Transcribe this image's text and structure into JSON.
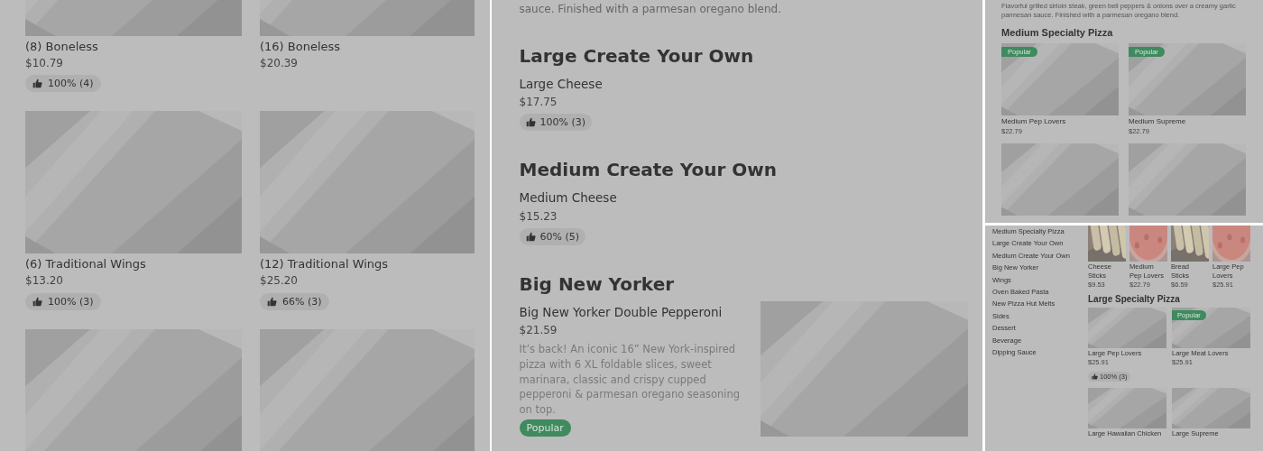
{
  "wings_panel": {
    "rows": [
      [
        {
          "kind": "card",
          "name": "(8) Boneless",
          "price": "$10.79",
          "rating": "100% (4)"
        },
        {
          "kind": "card",
          "name": "(16) Boneless",
          "price": "$20.39"
        }
      ],
      [
        {
          "kind": "card",
          "name": "(6) Traditional Wings",
          "price": "$13.20",
          "rating": "100% (3)"
        },
        {
          "kind": "card",
          "name": "(12) Traditional Wings",
          "price": "$25.20",
          "rating": "66% (3)"
        }
      ],
      [
        {
          "kind": "picture"
        },
        {
          "kind": "picture"
        }
      ]
    ]
  },
  "list_panel": {
    "intro": "sauce. Finished with a parmesan oregano blend.",
    "sections": [
      {
        "heading": "Large Create Your Own",
        "items": [
          {
            "kind": "plain",
            "name": "Large Cheese",
            "price": "$17.75",
            "rating": "100% (3)"
          }
        ]
      },
      {
        "heading": "Medium Create Your Own",
        "items": [
          {
            "kind": "plain",
            "name": "Medium Cheese",
            "price": "$15.23",
            "rating": "60% (5)"
          }
        ]
      },
      {
        "heading": "Big New Yorker",
        "items": [
          {
            "kind": "with_picture",
            "name": "Big New Yorker Double Pepperoni",
            "price": "$21.59",
            "description": "It’s back! An iconic 16” New York-inspired pizza with 6 XL foldable slices, sweet marinara, classic and crispy cupped pepperoni & parmesan oregano seasoning on top.",
            "badge": "Popular"
          }
        ]
      }
    ]
  },
  "medium_panel": {
    "intro": "Flavorful grilled sirloin steak, green bell peppers & onions over a creamy garlic parmesan sauce. Finished with a parmesan oregano blend.",
    "heading": "Medium Specialty Pizza",
    "rows": [
      [
        {
          "kind": "card",
          "badge": "Popular",
          "name": "Medium Pep Lovers",
          "price": "$22.79"
        },
        {
          "kind": "card",
          "badge": "Popular",
          "name": "Medium Supreme",
          "price": "$22.79"
        }
      ],
      [
        {
          "kind": "picture"
        },
        {
          "kind": "picture"
        }
      ]
    ]
  },
  "large_panel": {
    "nav": [
      "Medium Specialty Pizza",
      "Large Create Your Own",
      "Medium Create Your Own",
      "Big New Yorker",
      "Wings",
      "Oven Baked Pasta",
      "New Pizza Hut Melts",
      "Sides",
      "Dessert",
      "Beverage",
      "Dipping Sauce"
    ],
    "thumbs": [
      {
        "kind": "sticks",
        "name": "Cheese Sticks",
        "price": "$9.53"
      },
      {
        "kind": "pizza",
        "name": "Medium Pep Lovers",
        "price": "$22.79"
      },
      {
        "kind": "sticks",
        "name": "Bread Sticks",
        "price": "$6.59"
      },
      {
        "kind": "pizza",
        "name": "Large Pep Lovers",
        "price": "$25.91"
      }
    ],
    "heading": "Large Specialty Pizza",
    "rows": [
      [
        {
          "kind": "card",
          "name": "Large Pep Lovers",
          "price": "$25.91",
          "rating": "100% (3)"
        },
        {
          "kind": "card",
          "badge": "Popular",
          "name": "Large Meat Lovers",
          "price": "$25.91"
        }
      ],
      [
        {
          "kind": "card",
          "name": "Large Hawaiian Chicken"
        },
        {
          "kind": "card",
          "name": "Large Supreme"
        }
      ]
    ]
  }
}
